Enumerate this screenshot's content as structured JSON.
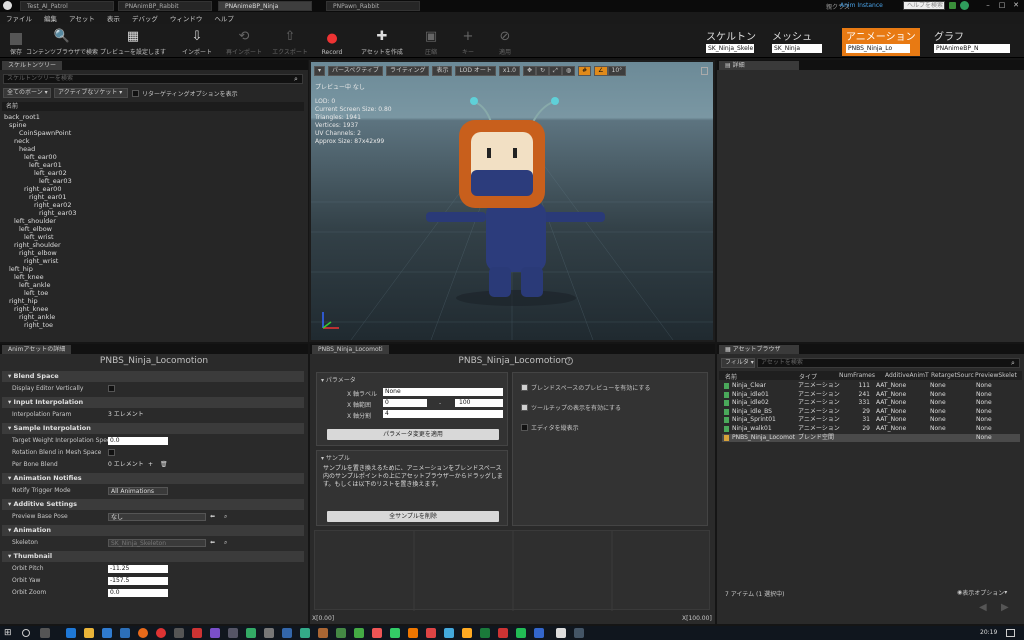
{
  "titlebar": {
    "tabs": [
      "Test_AI_Patrol",
      "PNAnimBP_Rabbit",
      "PNAnimeBP_Ninja",
      "PNPawn_Rabbit"
    ],
    "active_tab": 2,
    "parent_class_label": "親クラス",
    "parent_class_value": "Anim Instance",
    "help_search_placeholder": "ヘルプを検索"
  },
  "menu": [
    "ファイル",
    "編集",
    "アセット",
    "表示",
    "デバッグ",
    "ウィンドウ",
    "ヘルプ"
  ],
  "toolbar": {
    "buttons": [
      {
        "label": "保存",
        "icon": "save-icon",
        "disabled": false
      },
      {
        "label": "コンテンツブラウザで検索",
        "icon": "search-icon",
        "disabled": false
      },
      {
        "label": "プレビューを設定します",
        "icon": "preview-icon",
        "disabled": false
      },
      {
        "label": "インポート",
        "icon": "import-icon",
        "disabled": false
      },
      {
        "label": "再インポート",
        "icon": "reimport-icon",
        "disabled": true
      },
      {
        "label": "エクスポート",
        "icon": "export-icon",
        "disabled": true
      },
      {
        "label": "Record",
        "icon": "record-icon",
        "disabled": false
      },
      {
        "label": "アセットを作成",
        "icon": "create-asset-icon",
        "disabled": false
      },
      {
        "label": "圧縮",
        "icon": "compress-icon",
        "disabled": true
      },
      {
        "label": "キー",
        "icon": "key-icon",
        "disabled": true
      },
      {
        "label": "適用",
        "icon": "apply-icon",
        "disabled": true
      }
    ]
  },
  "modes": [
    {
      "title": "スケルトン",
      "sub": "SK_Ninja_Skele",
      "active": false
    },
    {
      "title": "メッシュ",
      "sub": "SK_Ninja",
      "active": false
    },
    {
      "title": "アニメーション",
      "sub": "PNBS_Ninja_Lo",
      "active": true
    },
    {
      "title": "グラフ",
      "sub": "PNAnimeBP_N",
      "active": false
    }
  ],
  "skeleton_tree": {
    "tab": "スケルトンツリー",
    "search_placeholder": "スケルトンツリーを検索",
    "filter_all_bones": "全てのボーン",
    "filter_sockets": "アクティブなソケット",
    "retarget_label": "リターゲティングオプションを表示",
    "column_header": "名前",
    "bones": [
      {
        "name": "back_root1",
        "depth": 0
      },
      {
        "name": "spine",
        "depth": 1
      },
      {
        "name": "CoinSpawnPoint",
        "depth": 3
      },
      {
        "name": "neck",
        "depth": 2
      },
      {
        "name": "head",
        "depth": 3
      },
      {
        "name": "left_ear00",
        "depth": 4
      },
      {
        "name": "left_ear01",
        "depth": 5
      },
      {
        "name": "left_ear02",
        "depth": 6
      },
      {
        "name": "left_ear03",
        "depth": 7
      },
      {
        "name": "right_ear00",
        "depth": 4
      },
      {
        "name": "right_ear01",
        "depth": 5
      },
      {
        "name": "right_ear02",
        "depth": 6
      },
      {
        "name": "right_ear03",
        "depth": 7
      },
      {
        "name": "left_shoulder",
        "depth": 2
      },
      {
        "name": "left_elbow",
        "depth": 3
      },
      {
        "name": "left_wrist",
        "depth": 4
      },
      {
        "name": "right_shoulder",
        "depth": 2
      },
      {
        "name": "right_elbow",
        "depth": 3
      },
      {
        "name": "right_wrist",
        "depth": 4
      },
      {
        "name": "left_hip",
        "depth": 1
      },
      {
        "name": "left_knee",
        "depth": 2
      },
      {
        "name": "left_ankle",
        "depth": 3
      },
      {
        "name": "left_toe",
        "depth": 4
      },
      {
        "name": "right_hip",
        "depth": 1
      },
      {
        "name": "right_knee",
        "depth": 2
      },
      {
        "name": "right_ankle",
        "depth": 3
      },
      {
        "name": "right_toe",
        "depth": 4
      }
    ]
  },
  "viewport": {
    "buttons": [
      "パースペクティブ",
      "ライティング",
      "表示",
      "LOD オート",
      "x1.0",
      "10°"
    ],
    "preview_label": "プレビュー中 なし",
    "stats": [
      "LOD: 0",
      "Current Screen Size: 0.80",
      "Triangles: 1941",
      "Vertices: 1937",
      "UV Channels: 2",
      "Approx Size: 87x42x99"
    ]
  },
  "details_top": {
    "tab": "詳細"
  },
  "anim_details": {
    "tab": "Animアセットの詳細",
    "title": "PNBS_Ninja_Locomotion",
    "sections": [
      {
        "name": "Blend Space",
        "rows": [
          {
            "label": "Display Editor Vertically",
            "type": "check",
            "value": ""
          }
        ]
      },
      {
        "name": "Input Interpolation",
        "rows": [
          {
            "label": "Interpolation Param",
            "type": "text",
            "value": "3 エレメント"
          }
        ]
      },
      {
        "name": "Sample Interpolation",
        "rows": [
          {
            "label": "Target Weight Interpolation Speed",
            "type": "num",
            "value": "0.0"
          },
          {
            "label": "Rotation Blend in Mesh Space",
            "type": "check",
            "value": ""
          },
          {
            "label": "Per Bone Blend",
            "type": "text",
            "value": "0 エレメント"
          }
        ]
      },
      {
        "name": "Animation Notifies",
        "rows": [
          {
            "label": "Notify Trigger Mode",
            "type": "combo",
            "value": "All Animations"
          }
        ]
      },
      {
        "name": "Additive Settings",
        "rows": [
          {
            "label": "Preview Base Pose",
            "type": "combo",
            "value": "なし"
          }
        ]
      },
      {
        "name": "Animation",
        "rows": [
          {
            "label": "Skeleton",
            "type": "combo",
            "value": "SK_Ninja_Skeleton"
          }
        ]
      },
      {
        "name": "Thumbnail",
        "rows": [
          {
            "label": "Orbit Pitch",
            "type": "num",
            "value": "-11.25"
          },
          {
            "label": "Orbit Yaw",
            "type": "num",
            "value": "-157.5"
          },
          {
            "label": "Orbit Zoom",
            "type": "num",
            "value": "0.0"
          }
        ]
      }
    ]
  },
  "blendspace": {
    "tab": "PNBS_Ninja_Locomoti",
    "title": "PNBS_Ninja_Locomotion",
    "params_header": "パラメータ",
    "x_label_name": "X 軸ラベル",
    "x_label_value": "None",
    "x_range_name": "X 軸範囲",
    "x_range_min": "0",
    "x_range_sep": "-",
    "x_range_max": "100",
    "x_div_name": "X 軸分割",
    "x_div_value": "4",
    "apply_button": "パラメータ変更を適用",
    "sample_header": "サンプル",
    "sample_text": "サンプルを置き換えるために、アニメーションをブレンドスペース内のサンプルポイントの上にアセットブラウザーからドラッグします。もしくは以下のリストを置き換えます。",
    "delete_button": "全サンプルを削除",
    "opt_preview": "ブレンドスペースのプレビューを有効にする",
    "opt_tooltip": "ツールチップの表示を有効にする",
    "opt_vertical": "エディタを縦表示",
    "axis_min": "X[0.00]",
    "axis_max": "X[100.00]"
  },
  "asset_browser": {
    "tab": "アセットブラウザ",
    "filter_label": "フィルタ",
    "search_placeholder": "アセットを検索",
    "columns": [
      "名前",
      "タイプ",
      "NumFrames",
      "AdditiveAnimT",
      "RetargetSourc",
      "PreviewSkelet"
    ],
    "rows": [
      {
        "name": "Ninja_Clear",
        "type": "アニメーション",
        "frames": "111",
        "additive": "AAT_None",
        "retarget": "None",
        "preview": "None",
        "selected": false
      },
      {
        "name": "Ninja_idle01",
        "type": "アニメーション",
        "frames": "241",
        "additive": "AAT_None",
        "retarget": "None",
        "preview": "None",
        "selected": false
      },
      {
        "name": "Ninja_idle02",
        "type": "アニメーション",
        "frames": "331",
        "additive": "AAT_None",
        "retarget": "None",
        "preview": "None",
        "selected": false
      },
      {
        "name": "Ninja_idle_BS",
        "type": "アニメーション",
        "frames": "29",
        "additive": "AAT_None",
        "retarget": "None",
        "preview": "None",
        "selected": false
      },
      {
        "name": "Ninja_Sprint01",
        "type": "アニメーション",
        "frames": "31",
        "additive": "AAT_None",
        "retarget": "None",
        "preview": "None",
        "selected": false
      },
      {
        "name": "Ninja_walk01",
        "type": "アニメーション",
        "frames": "29",
        "additive": "AAT_None",
        "retarget": "None",
        "preview": "None",
        "selected": false
      },
      {
        "name": "PNBS_Ninja_Locomot",
        "type": "ブレンド空間",
        "frames": "",
        "additive": "",
        "retarget": "",
        "preview": "None",
        "selected": true
      }
    ],
    "count_label": "7 アイテム (1 選択中)",
    "view_options": "表示オプション"
  },
  "taskbar": {
    "time": "20:19"
  }
}
